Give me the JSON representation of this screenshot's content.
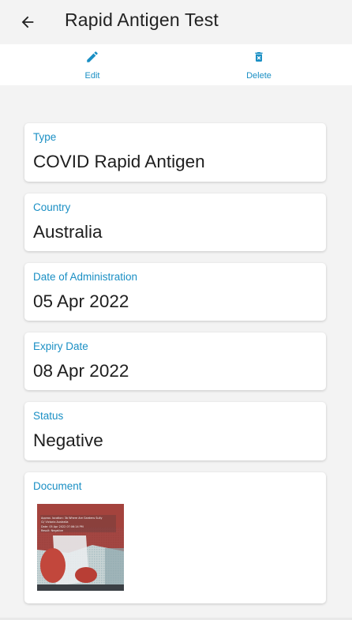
{
  "header": {
    "title": "Rapid Antigen Test",
    "back_icon": "arrow-left-icon"
  },
  "actions": {
    "edit": {
      "label": "Edit",
      "icon": "pencil-icon"
    },
    "delete": {
      "label": "Delete",
      "icon": "trash-icon"
    }
  },
  "fields": {
    "type": {
      "label": "Type",
      "value": "COVID Rapid Antigen"
    },
    "country": {
      "label": "Country",
      "value": "Australia"
    },
    "date_of_administration": {
      "label": "Date of Administration",
      "value": "05 Apr 2022"
    },
    "expiry_date": {
      "label": "Expiry Date",
      "value": "08 Apr 2022"
    },
    "status": {
      "label": "Status",
      "value": "Negative"
    }
  },
  "document": {
    "label": "Document",
    "thumbnail_caption": "Approx. location: 3b Where Are Gardens Sully Cl/ Victoria Australia\nDate: 05 Apr 2022 07:06:14 PM\nResult: Negative"
  },
  "colors": {
    "accent": "#1a8fc4",
    "background": "#f3f3f3",
    "card": "#ffffff"
  }
}
